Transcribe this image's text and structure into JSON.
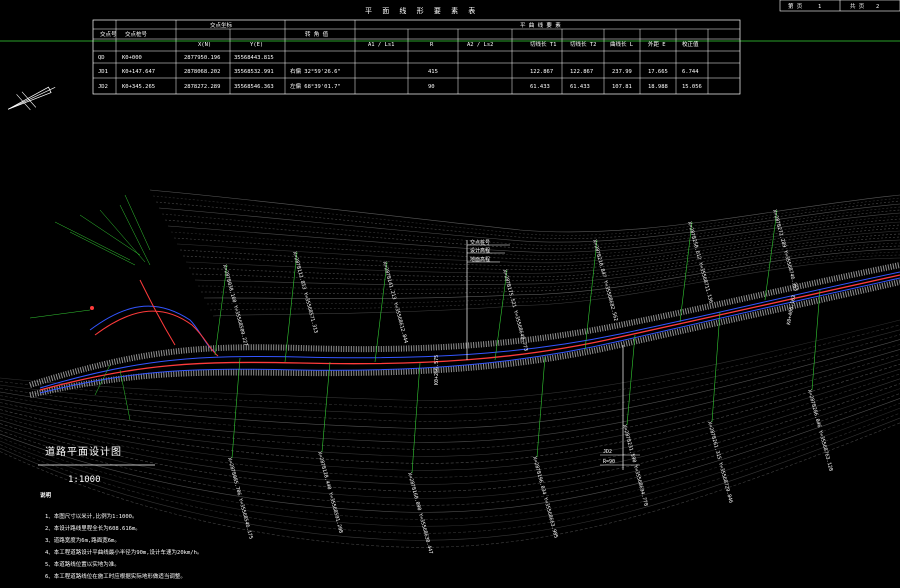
{
  "title_block": {
    "page_label": "第 页",
    "page_no": "1",
    "total_label": "共 页",
    "total_no": "2"
  },
  "table": {
    "title": "平 面 线 形 要 素 表",
    "group_coord": "交点坐标",
    "group_curve": "平 曲 线 要 素",
    "col_no": "交点号",
    "col_station": "交点桩号",
    "col_x": "X(N)",
    "col_y": "Y(E)",
    "col_angle": "转 角 值",
    "col_a1": "A1 / Ls1",
    "col_r": "R",
    "col_a2": "A2 / Ls2",
    "col_t1": "切线长 T1",
    "col_t2": "切线长 T2",
    "col_l": "曲线长 L",
    "col_e": "外距 E",
    "col_d": "校正值",
    "rows": [
      {
        "no": "QD",
        "station": "K0+000",
        "x": "2877950.196",
        "y": "35568443.815",
        "angle": "",
        "a1": "",
        "r": "",
        "a2": "",
        "t1": "",
        "t2": "",
        "l": "",
        "e": "",
        "d": ""
      },
      {
        "no": "JD1",
        "station": "K0+147.647",
        "x": "2878068.202",
        "y": "35568532.991",
        "angle": "右偏 32°59'26.6\"",
        "a1": "",
        "r": "415",
        "a2": "",
        "t1": "122.867",
        "t2": "122.867",
        "l": "237.99",
        "e": "17.665",
        "d": "6.744"
      },
      {
        "no": "JD2",
        "station": "K0+345.265",
        "x": "2878272.289",
        "y": "35568546.363",
        "angle": "左偏 68°39'01.7\"",
        "a1": "",
        "r": "90",
        "a2": "",
        "t1": "61.433",
        "t2": "61.433",
        "l": "107.81",
        "e": "18.988",
        "d": "15.056"
      }
    ]
  },
  "drawing": {
    "title": "道路平面设计图",
    "scale": "1:1000",
    "notes_heading": "说明",
    "notes": [
      "1、本图尺寸以米计,比例为1:1000。",
      "2、本设计路线里程全长为608.616m。",
      "3、道路宽度为6m,路面宽6m。",
      "4、本工程道路设计平曲线最小半径为90m,设计车速为20km/h。",
      "5、本道路线位置以实地为准。",
      "6、本工程道路线位在施工时应根据实际地形做适当调整。"
    ],
    "station_mid": "K0+256.575",
    "station_far": "K0+406.163",
    "coords": [
      "X=2878038.160 Y=35568509.227",
      "X=2878085.706 Y=35568546.175",
      "X=2878112.853 Y=35568571.313",
      "X=2878128.440 Y=35568591.208",
      "X=2878141.213 Y=35568612.844",
      "X=2878160.090 Y=35568630.447",
      "X=2878175.521 Y=35568648.773",
      "X=2878196.034 Y=35568663.985",
      "X=2878210.847 Y=35568682.562",
      "X=2878231.590 Y=35568694.778",
      "X=2878250.612 Y=35568711.136",
      "X=2878261.315 Y=35568729.846",
      "X=2878272.289 Y=35568746.363",
      "X=2878286.046 Y=35568763.128"
    ],
    "legend": [
      "交点桩号",
      "设计高程",
      "地面高程"
    ],
    "legend_lower": [
      "JD2",
      "R=90"
    ]
  },
  "colors": {
    "background": "#000000",
    "road": "#ff3b3b",
    "edge": "#3355ff",
    "label": "#33cc33",
    "contour": "#9a9a9a"
  }
}
